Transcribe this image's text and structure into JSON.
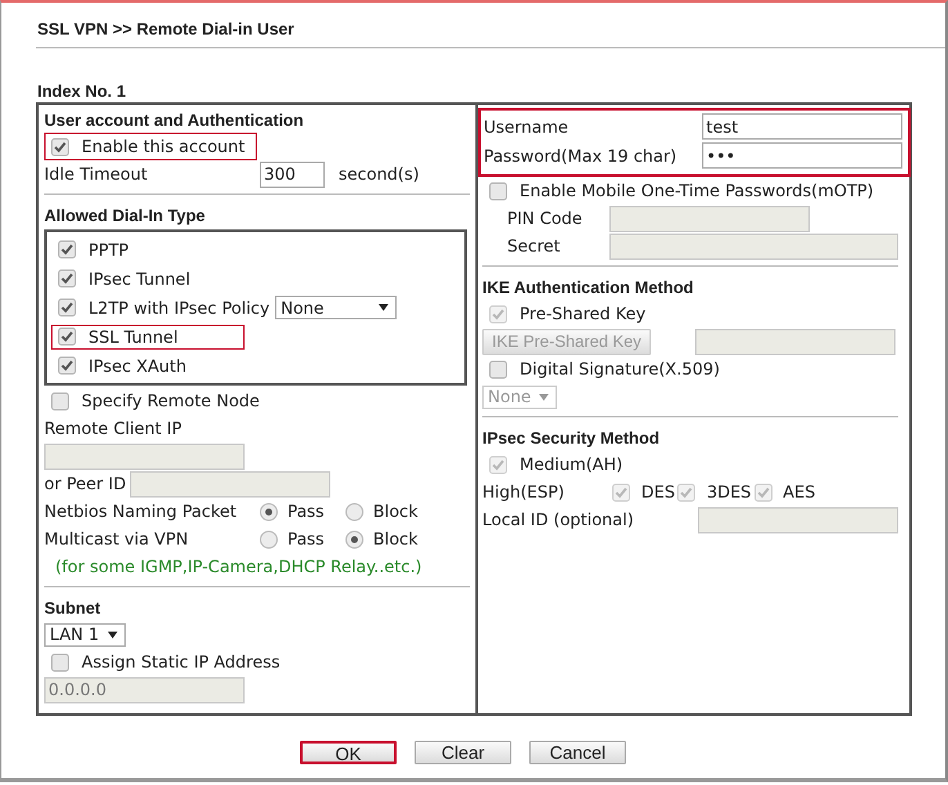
{
  "breadcrumb": "SSL VPN >> Remote Dial-in User",
  "index_label": "Index No. 1",
  "columns": [
    {
      "sections": [
        {
          "heading": "User account and Authentication",
          "rows": [
            {
              "kind": "checkbox",
              "label": "Enable this account",
              "checked": true,
              "disabled": false,
              "highlighted": true
            },
            {
              "kind": "field-row",
              "label": "Idle Timeout",
              "value": "300",
              "unit": "second(s)",
              "disabled": false
            }
          ]
        },
        {
          "heading": "Allowed Dial-In Type",
          "rows": [
            {
              "kind": "checkbox-group",
              "items": [
                {
                  "label": "PPTP",
                  "checked": true,
                  "highlighted": false
                },
                {
                  "label": "IPsec Tunnel",
                  "checked": true,
                  "highlighted": false
                },
                {
                  "label": "L2TP with IPsec Policy",
                  "checked": true,
                  "highlighted": false,
                  "select": {
                    "value": "None",
                    "disabled": false
                  }
                },
                {
                  "label": "SSL Tunnel",
                  "checked": true,
                  "highlighted": true
                },
                {
                  "label": "IPsec XAuth",
                  "checked": true,
                  "highlighted": false
                }
              ]
            },
            {
              "kind": "checkbox",
              "label": "Specify Remote Node",
              "checked": false,
              "disabled": false,
              "highlighted": false
            },
            {
              "kind": "label",
              "label": "Remote Client IP"
            },
            {
              "kind": "field",
              "disabled": true
            },
            {
              "kind": "inline-field",
              "label": "or Peer ID",
              "disabled": true
            },
            {
              "kind": "radio",
              "label": "Netbios Naming Packet",
              "options": [
                {
                  "label": "Pass",
                  "selected": true
                },
                {
                  "label": "Block",
                  "selected": false
                }
              ]
            },
            {
              "kind": "radio",
              "label": "Multicast via VPN",
              "options": [
                {
                  "label": "Pass",
                  "selected": false
                },
                {
                  "label": "Block",
                  "selected": true
                }
              ]
            },
            {
              "kind": "note",
              "text": "(for some IGMP,IP-Camera,DHCP Relay..etc.)"
            }
          ]
        },
        {
          "heading": "Subnet",
          "rows": [
            {
              "kind": "select",
              "value": "LAN 1",
              "disabled": false
            },
            {
              "kind": "checkbox",
              "label": "Assign Static IP Address",
              "checked": false,
              "disabled": false,
              "highlighted": false
            },
            {
              "kind": "field",
              "value": "0.0.0.0",
              "disabled": true
            }
          ]
        }
      ]
    },
    {
      "sections": [
        {
          "rows": [
            {
              "kind": "field-group",
              "highlighted": true,
              "fields": [
                {
                  "label": "Username",
                  "value": "test",
                  "disabled": false
                },
                {
                  "label": "Password(Max 19 char)",
                  "value": "•••",
                  "disabled": false
                }
              ]
            },
            {
              "kind": "checkbox",
              "label": "Enable Mobile One-Time Passwords(mOTP)",
              "checked": false,
              "disabled": false,
              "highlighted": false
            },
            {
              "kind": "sub-field",
              "label": "PIN Code",
              "disabled": true
            },
            {
              "kind": "sub-field",
              "label": "Secret",
              "disabled": true
            }
          ]
        },
        {
          "heading": "IKE Authentication Method",
          "rows": [
            {
              "kind": "checkbox",
              "label": "Pre-Shared Key",
              "checked": true,
              "disabled": true,
              "highlighted": false
            },
            {
              "kind": "button-field",
              "button": {
                "label": "IKE Pre-Shared Key",
                "disabled": true
              },
              "disabled": true
            },
            {
              "kind": "checkbox",
              "label": "Digital Signature(X.509)",
              "checked": false,
              "disabled": false,
              "highlighted": false
            },
            {
              "kind": "select",
              "value": "None",
              "disabled": true
            }
          ]
        },
        {
          "heading": "IPsec Security Method",
          "rows": [
            {
              "kind": "checkbox",
              "label": "Medium(AH)",
              "checked": true,
              "disabled": true,
              "highlighted": false
            },
            {
              "kind": "checkbox-row",
              "label": "High(ESP)",
              "items": [
                {
                  "label": "DES",
                  "checked": true,
                  "disabled": true
                },
                {
                  "label": "3DES",
                  "checked": true,
                  "disabled": true
                },
                {
                  "label": "AES",
                  "checked": true,
                  "disabled": true
                }
              ]
            },
            {
              "kind": "field-row",
              "label": "Local ID (optional)",
              "disabled": true
            }
          ]
        }
      ]
    }
  ],
  "buttons": [
    {
      "label": "OK",
      "highlighted": true
    },
    {
      "label": "Clear",
      "highlighted": false
    },
    {
      "label": "Cancel",
      "highlighted": false
    }
  ]
}
